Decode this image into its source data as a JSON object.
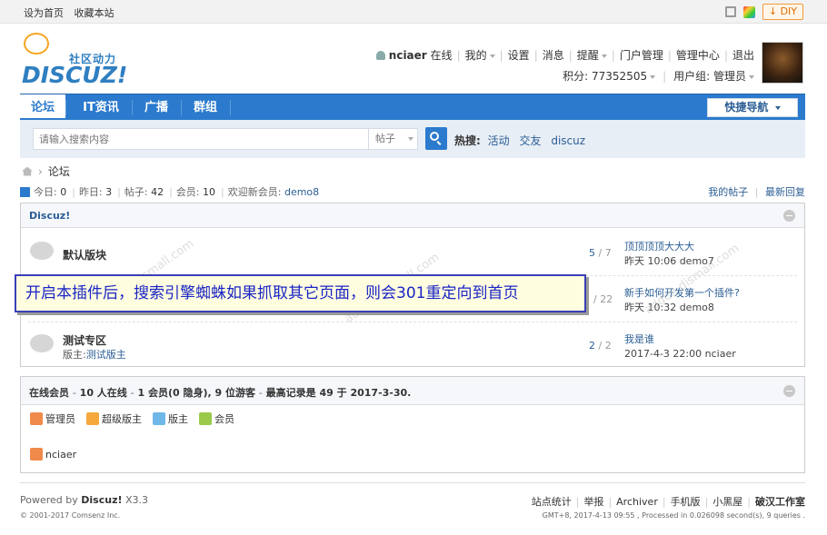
{
  "topbar": {
    "set_home": "设为首页",
    "bookmark": "收藏本站",
    "diy": "DIY"
  },
  "logo": {
    "slogan": "社区动力",
    "brand": "DISCUZ!"
  },
  "user": {
    "name": "nciaer",
    "status": "在线",
    "my": "我的",
    "settings": "设置",
    "messages": "消息",
    "reminders": "提醒",
    "portal_admin": "门户管理",
    "admin_center": "管理中心",
    "logout": "退出",
    "points": "积分: 77352505",
    "group": "用户组: 管理员"
  },
  "nav": {
    "items": [
      {
        "label": "论坛"
      },
      {
        "label": "IT资讯"
      },
      {
        "label": "广播"
      },
      {
        "label": "群组"
      }
    ],
    "quick_nav": "快捷导航"
  },
  "search": {
    "placeholder": "请输入搜索内容",
    "type": "帖子",
    "hot_label": "热搜:",
    "hot": [
      "活动",
      "交友",
      "discuz"
    ]
  },
  "breadcrumb": {
    "current": "论坛"
  },
  "stats": {
    "today_label": "今日:",
    "today": "0",
    "yesterday_label": "昨日:",
    "yesterday": "3",
    "posts_label": "帖子:",
    "posts": "42",
    "members_label": "会员:",
    "members": "10",
    "welcome_label": "欢迎新会员:",
    "newest": "demo8",
    "my_posts": "我的帖子",
    "latest_replies": "最新回复"
  },
  "forum": {
    "category": "Discuz!",
    "rows": [
      {
        "name": "默认版块",
        "mod_label": "",
        "mod": "",
        "threads": "5",
        "posts": "7",
        "last_title": "顶顶顶顶大大大",
        "last_meta": "昨天 10:06 demo7"
      },
      {
        "name": "",
        "mod_label": "",
        "mod": "",
        "threads": "",
        "posts": "22",
        "last_title": "新手如何开发第一个插件?",
        "last_meta": "昨天 10:32 demo8"
      },
      {
        "name": "测试专区",
        "mod_label": "版主:",
        "mod": "测试版主",
        "threads": "2",
        "posts": "2",
        "last_title": "我是谁",
        "last_meta": "2017-4-3 22:00 nciaer"
      }
    ]
  },
  "online": {
    "title": "在线会员",
    "total": "10 人在线",
    "members": "1 会员(0 隐身), 9 位游客",
    "record": "最高记录是 49 于 2017-3-30.",
    "legend": [
      {
        "label": "管理员",
        "color": "#f08a4b"
      },
      {
        "label": "超级版主",
        "color": "#f5a93d"
      },
      {
        "label": "版主",
        "color": "#6fb7e8"
      },
      {
        "label": "会员",
        "color": "#9bc94a"
      }
    ],
    "users": [
      {
        "name": "nciaer",
        "color": "#f08a4b"
      }
    ]
  },
  "footer": {
    "powered_by": "Powered by",
    "product": "Discuz!",
    "version": "X3.3",
    "copyright": "© 2001-2017 Comsenz Inc.",
    "links": [
      "站点统计",
      "举报",
      "Archiver",
      "手机版",
      "小黑屋"
    ],
    "studio": "破汉工作室",
    "processed": "GMT+8, 2017-4-13 09:55 , Processed in 0.026098 second(s), 9 queries ."
  },
  "banner": {
    "text": "开启本插件后，搜索引擎蜘蛛如果抓取其它页面，则会301重定向到首页"
  },
  "colors": {
    "accent": "#2b7acd",
    "link": "#2b5e95",
    "banner_border": "#3b3fb6",
    "banner_bg": "#fffde0"
  }
}
